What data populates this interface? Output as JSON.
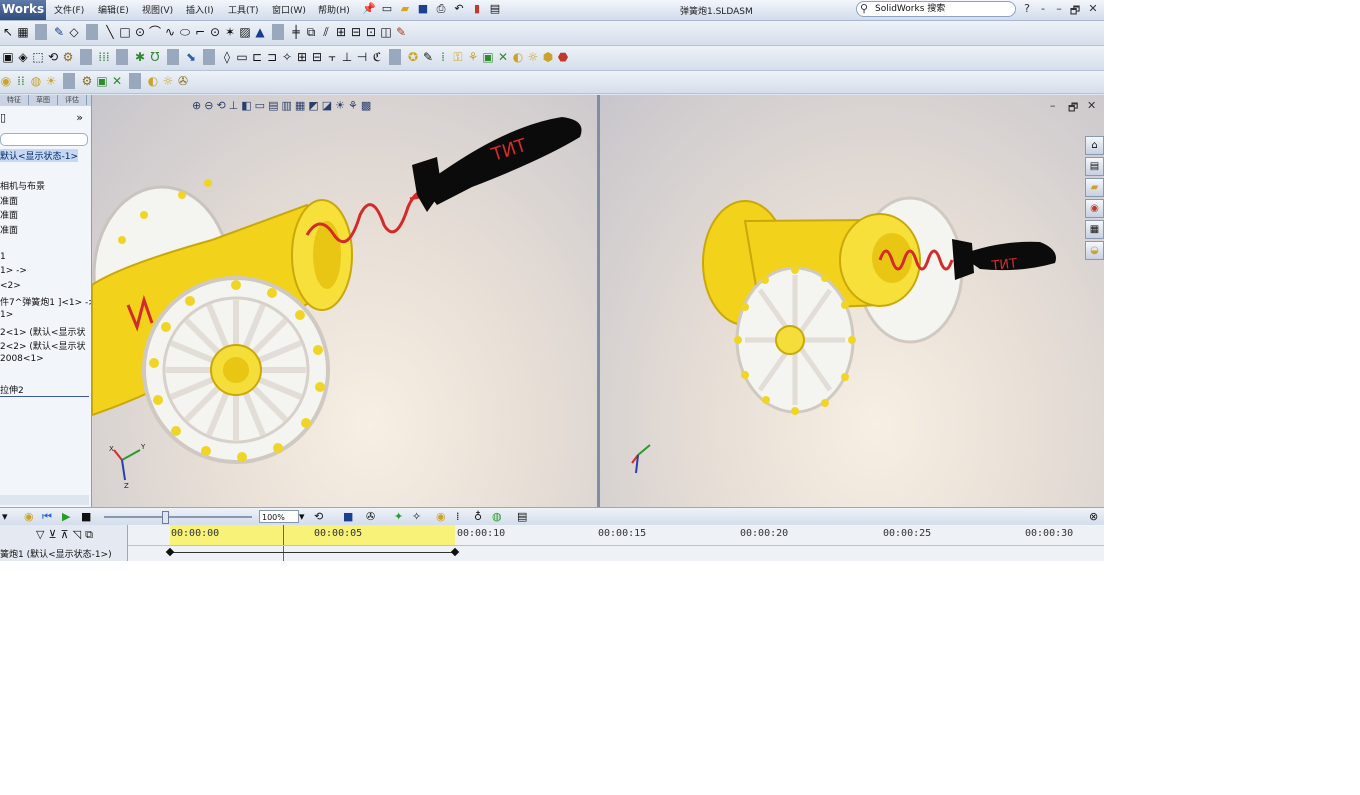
{
  "app": {
    "name": "Works",
    "document_title": "弹簧炮1.SLDASM",
    "search_placeholder": "SolidWorks 搜索"
  },
  "menu": [
    "文件(F)",
    "编辑(E)",
    "视图(V)",
    "插入(I)",
    "工具(T)",
    "窗口(W)",
    "帮助(H)"
  ],
  "window_controls": [
    "?",
    "-",
    "–",
    "🗗",
    "✕"
  ],
  "feature_tree": {
    "tabs": [
      "特征",
      "草图",
      "评估"
    ],
    "items": [
      {
        "label": "默认<显示状态-1>",
        "highlight": true
      },
      {
        "label": "相机与布景",
        "highlight": false
      },
      {
        "label": "准面",
        "highlight": false
      },
      {
        "label": "准面",
        "highlight": false
      },
      {
        "label": "准面",
        "highlight": false
      },
      {
        "label": "1",
        "highlight": false
      },
      {
        "label": "1> ->",
        "highlight": false
      },
      {
        "label": "<2>",
        "highlight": false
      },
      {
        "label": "件7^弹簧炮1 ]<1> ->",
        "highlight": false
      },
      {
        "label": "1>",
        "highlight": false
      },
      {
        "label": "2<1> (默认<显示状",
        "highlight": false
      },
      {
        "label": "2<2> (默认<显示状",
        "highlight": false
      },
      {
        "label": "2008<1>",
        "highlight": false
      },
      {
        "label": "拉伸2",
        "highlight": false
      }
    ]
  },
  "motion": {
    "zoom": "100%",
    "time_marks": [
      "00:00:00",
      "00:00:05",
      "00:00:10",
      "00:00:15",
      "00:00:20",
      "00:00:25",
      "00:00:30"
    ],
    "row_label": "簧炮1 (默认<显示状态-1>)"
  },
  "scene": {
    "rocket_text": "ТИТ",
    "colors": {
      "cannon": "#f2d21a",
      "spring": "#d42a2a",
      "rocket": "#0b0b0b",
      "wheel": "#f4f4f1"
    }
  }
}
